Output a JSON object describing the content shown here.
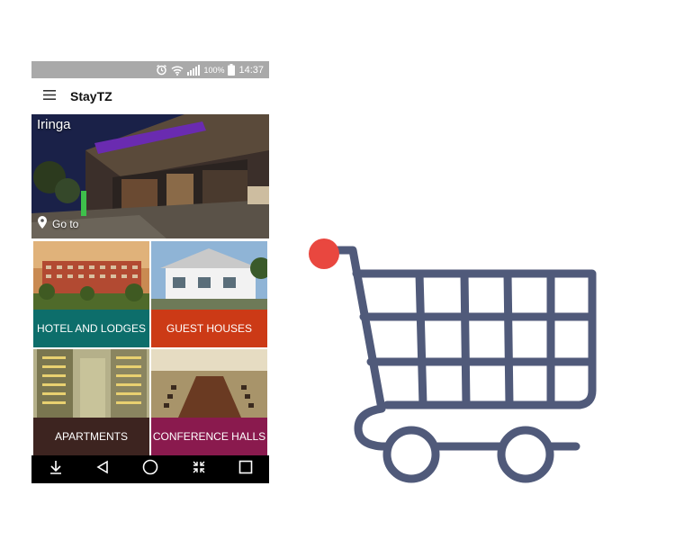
{
  "status_bar": {
    "battery": "100%",
    "time": "14:37"
  },
  "app_bar": {
    "title": "StayTZ"
  },
  "hero": {
    "city": "Iringa",
    "goto_label": "Go to"
  },
  "categories": [
    {
      "label": "HOTEL AND LODGES",
      "color": "#0d6e6b"
    },
    {
      "label": "GUEST HOUSES",
      "color": "#cc3a16"
    },
    {
      "label": "APARTMENTS",
      "color": "#3d2420"
    },
    {
      "label": "CONFERENCE HALLS",
      "color": "#8a1a4e"
    }
  ],
  "cart_icon": {
    "body_color": "#505a7a",
    "dot_color": "#e9473f"
  }
}
